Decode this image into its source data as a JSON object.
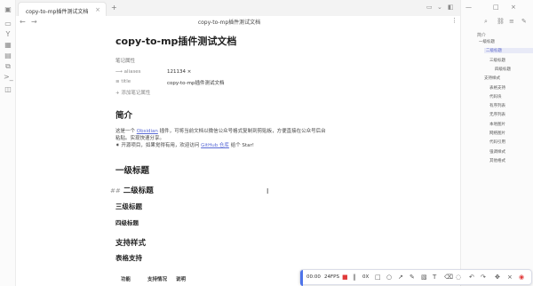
{
  "tab": {
    "title": "copy-to-mp插件测试文档",
    "close_icon": "close-icon"
  },
  "editor": {
    "header_title": "copy-to-mp插件测试文档"
  },
  "doc": {
    "title": "copy-to-mp插件测试文档",
    "properties_label": "笔记属性",
    "properties": [
      {
        "key": "aliases",
        "value": "121134"
      },
      {
        "key": "title",
        "value": "copy-to-mp插件测试文档"
      }
    ],
    "add_property": "添加笔记属性",
    "intro_heading": "简介",
    "intro_line1_pre": "这是一个",
    "intro_link1": "Obsidian",
    "intro_line1_post": "插件，可将当前文档以微信公众号格式复制到剪贴板，方便直接在公众号后台",
    "intro_line2": "粘贴。实现快速分享。",
    "intro_line3_pre": "开源项目，如果觉得有用，欢迎访问",
    "intro_link2": "GitHub 仓库",
    "intro_line3_post": "给个 Star!",
    "h1": "一级标题",
    "h2_marker": "##",
    "h2": "二级标题",
    "h3": "三级标题",
    "h4": "四级标题",
    "section_styles": "支持样式",
    "section_tables": "表格支持",
    "table_headers": [
      "功能",
      "支持情况",
      "说明"
    ]
  },
  "outline": {
    "title": "简介",
    "items": [
      {
        "label": "一级标题",
        "level": 1,
        "active": false
      },
      {
        "label": "二级标题",
        "level": 2,
        "active": true
      },
      {
        "label": "三级标题",
        "level": 3,
        "active": false
      },
      {
        "label": "四级标题",
        "level": 4,
        "active": false
      },
      {
        "label": "支持样式",
        "level": 2,
        "active": false
      },
      {
        "label": "表格支持",
        "level": 3,
        "active": false
      },
      {
        "label": "代码块",
        "level": 3,
        "active": false
      },
      {
        "label": "有序列表",
        "level": 3,
        "active": false
      },
      {
        "label": "无序列表",
        "level": 3,
        "active": false
      },
      {
        "label": "本地图片",
        "level": 3,
        "active": false
      },
      {
        "label": "网络图片",
        "level": 3,
        "active": false
      },
      {
        "label": "代码引用",
        "level": 3,
        "active": false
      },
      {
        "label": "强调样式",
        "level": 3,
        "active": false
      },
      {
        "label": "其他格式",
        "level": 3,
        "active": false
      }
    ]
  },
  "recorder": {
    "time": "00:00",
    "fps": "24FPS",
    "zoom": "0X"
  },
  "colors": {
    "accent": "#5b66c9",
    "link": "#5a6bd6",
    "record": "#e03a3a"
  }
}
